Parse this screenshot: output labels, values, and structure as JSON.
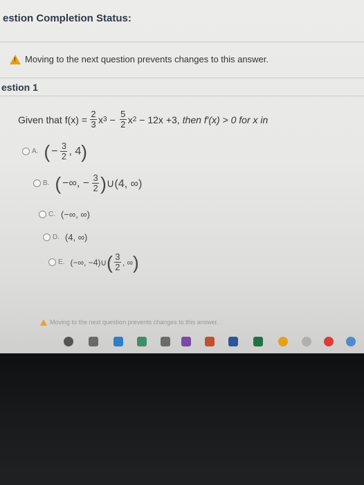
{
  "header": {
    "title": "estion Completion Status:"
  },
  "warning": {
    "text": "Moving to the next question prevents changes to this answer."
  },
  "question": {
    "label": "estion 1",
    "prefix": "Given that f(x) =",
    "f1_num": "2",
    "f1_den": "3",
    "x3": "x",
    "p3": "3",
    "minus1": "−",
    "f2_num": "5",
    "f2_den": "2",
    "x2": "x",
    "p2": "2",
    "rest": "− 12x +3,",
    "then": "then f′(x) > 0 for x in"
  },
  "options": [
    {
      "letter": "A.",
      "lp": "(",
      "neg": "−",
      "num": "3",
      "den": "2",
      "tail": ", 4",
      "rp": ")"
    },
    {
      "letter": "B.",
      "lp": "(",
      "head": "−∞, −",
      "num": "3",
      "den": "2",
      "rp": ")",
      "tail": "∪(4, ∞)"
    },
    {
      "letter": "C.",
      "text": "(−∞, ∞)"
    },
    {
      "letter": "D.",
      "text": "(4, ∞)"
    },
    {
      "letter": "E.",
      "head": "(−∞, −4)∪",
      "lp": "(",
      "num": "3",
      "den": "2",
      "tail": ", ∞",
      "rp": ")"
    }
  ],
  "footer_warning": {
    "text": "Moving to the next question prevents changes to this answer."
  },
  "taskbar": {
    "icons": [
      {
        "name": "circle-icon",
        "color": "#555555"
      },
      {
        "name": "task-view-icon",
        "color": "#6a6a6a"
      },
      {
        "name": "edge-icon",
        "color": "#2f7ec9"
      },
      {
        "name": "store-icon",
        "color": "#3e8e6a"
      },
      {
        "name": "file-explorer-icon",
        "color": "#6b6b6b"
      },
      {
        "name": "onenote-icon",
        "color": "#7b4aa5"
      },
      {
        "name": "powerpoint-icon",
        "color": "#c1502e"
      },
      {
        "name": "word-icon",
        "color": "#2b579a"
      },
      {
        "name": "excel-icon",
        "color": "#217346"
      },
      {
        "name": "chrome-icon",
        "color": "#e3a21a"
      },
      {
        "name": "app-icon",
        "color": "#b0b0b0"
      },
      {
        "name": "opera-icon",
        "color": "#e03a3a"
      },
      {
        "name": "app2-icon",
        "color": "#4f8ad1"
      }
    ]
  }
}
